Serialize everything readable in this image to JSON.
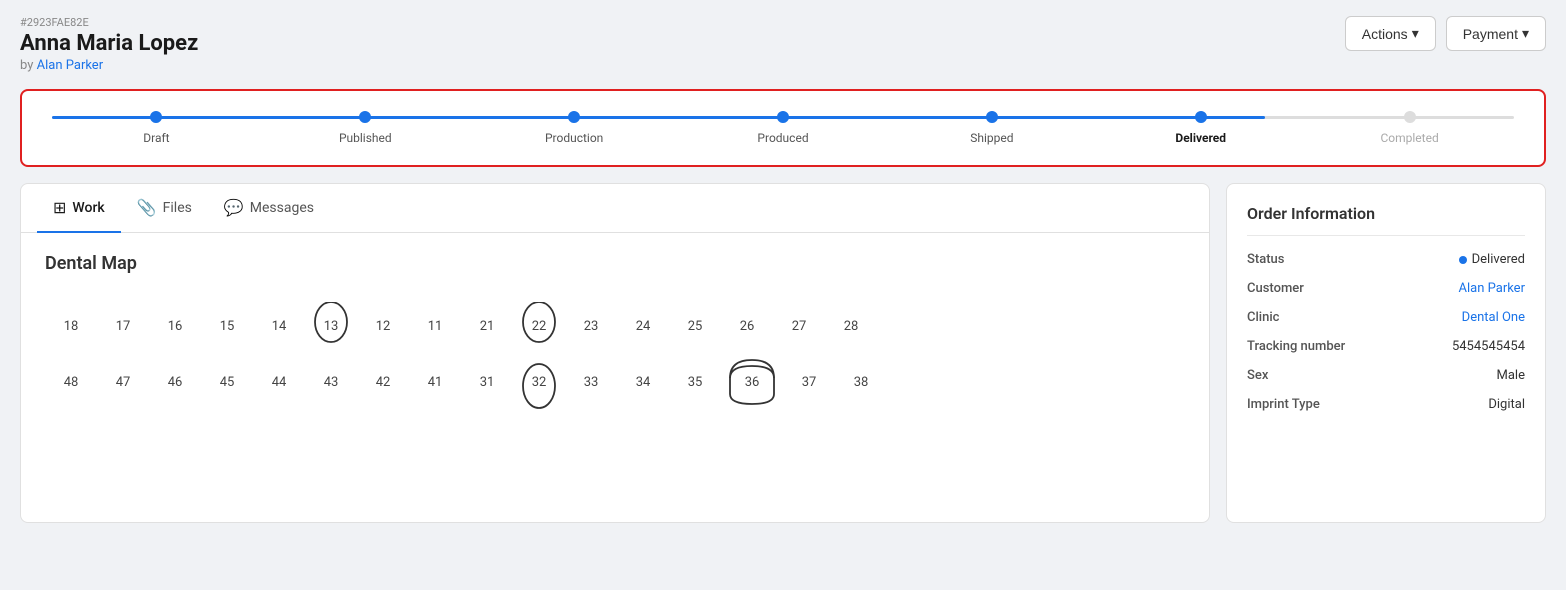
{
  "header": {
    "order_id": "#2923FAE82E",
    "patient_name": "Anna Maria Lopez",
    "by_label": "by",
    "author": "Alan Parker",
    "actions_label": "Actions",
    "payment_label": "Payment"
  },
  "progress": {
    "steps": [
      {
        "id": "draft",
        "label": "Draft",
        "active": true,
        "current": false
      },
      {
        "id": "published",
        "label": "Published",
        "active": true,
        "current": false
      },
      {
        "id": "production",
        "label": "Production",
        "active": true,
        "current": false
      },
      {
        "id": "produced",
        "label": "Produced",
        "active": true,
        "current": false
      },
      {
        "id": "shipped",
        "label": "Shipped",
        "active": true,
        "current": false
      },
      {
        "id": "delivered",
        "label": "Delivered",
        "active": true,
        "current": true
      },
      {
        "id": "completed",
        "label": "Completed",
        "active": false,
        "current": false
      }
    ]
  },
  "tabs": [
    {
      "id": "work",
      "label": "Work",
      "active": true
    },
    {
      "id": "files",
      "label": "Files",
      "active": false
    },
    {
      "id": "messages",
      "label": "Messages",
      "active": false
    }
  ],
  "dental_map": {
    "title": "Dental Map",
    "upper_row": [
      18,
      17,
      16,
      15,
      14,
      13,
      12,
      11,
      21,
      22,
      23,
      24,
      25,
      26,
      27,
      28
    ],
    "lower_row": [
      48,
      47,
      46,
      45,
      44,
      43,
      42,
      41,
      31,
      32,
      33,
      34,
      35,
      36,
      37,
      38
    ],
    "circled_teeth": [
      13,
      22,
      32
    ],
    "crowned_teeth": [
      36
    ]
  },
  "order_info": {
    "title": "Order Information",
    "fields": [
      {
        "label": "Status",
        "value": "Delivered",
        "type": "status"
      },
      {
        "label": "Customer",
        "value": "Alan Parker",
        "type": "link"
      },
      {
        "label": "Clinic",
        "value": "Dental One",
        "type": "link"
      },
      {
        "label": "Tracking number",
        "value": "5454545454",
        "type": "text"
      },
      {
        "label": "Sex",
        "value": "Male",
        "type": "text"
      },
      {
        "label": "Imprint Type",
        "value": "Digital",
        "type": "text"
      }
    ]
  },
  "colors": {
    "accent": "#1a73e8",
    "danger": "#e02020",
    "status_delivered": "#1a73e8"
  }
}
